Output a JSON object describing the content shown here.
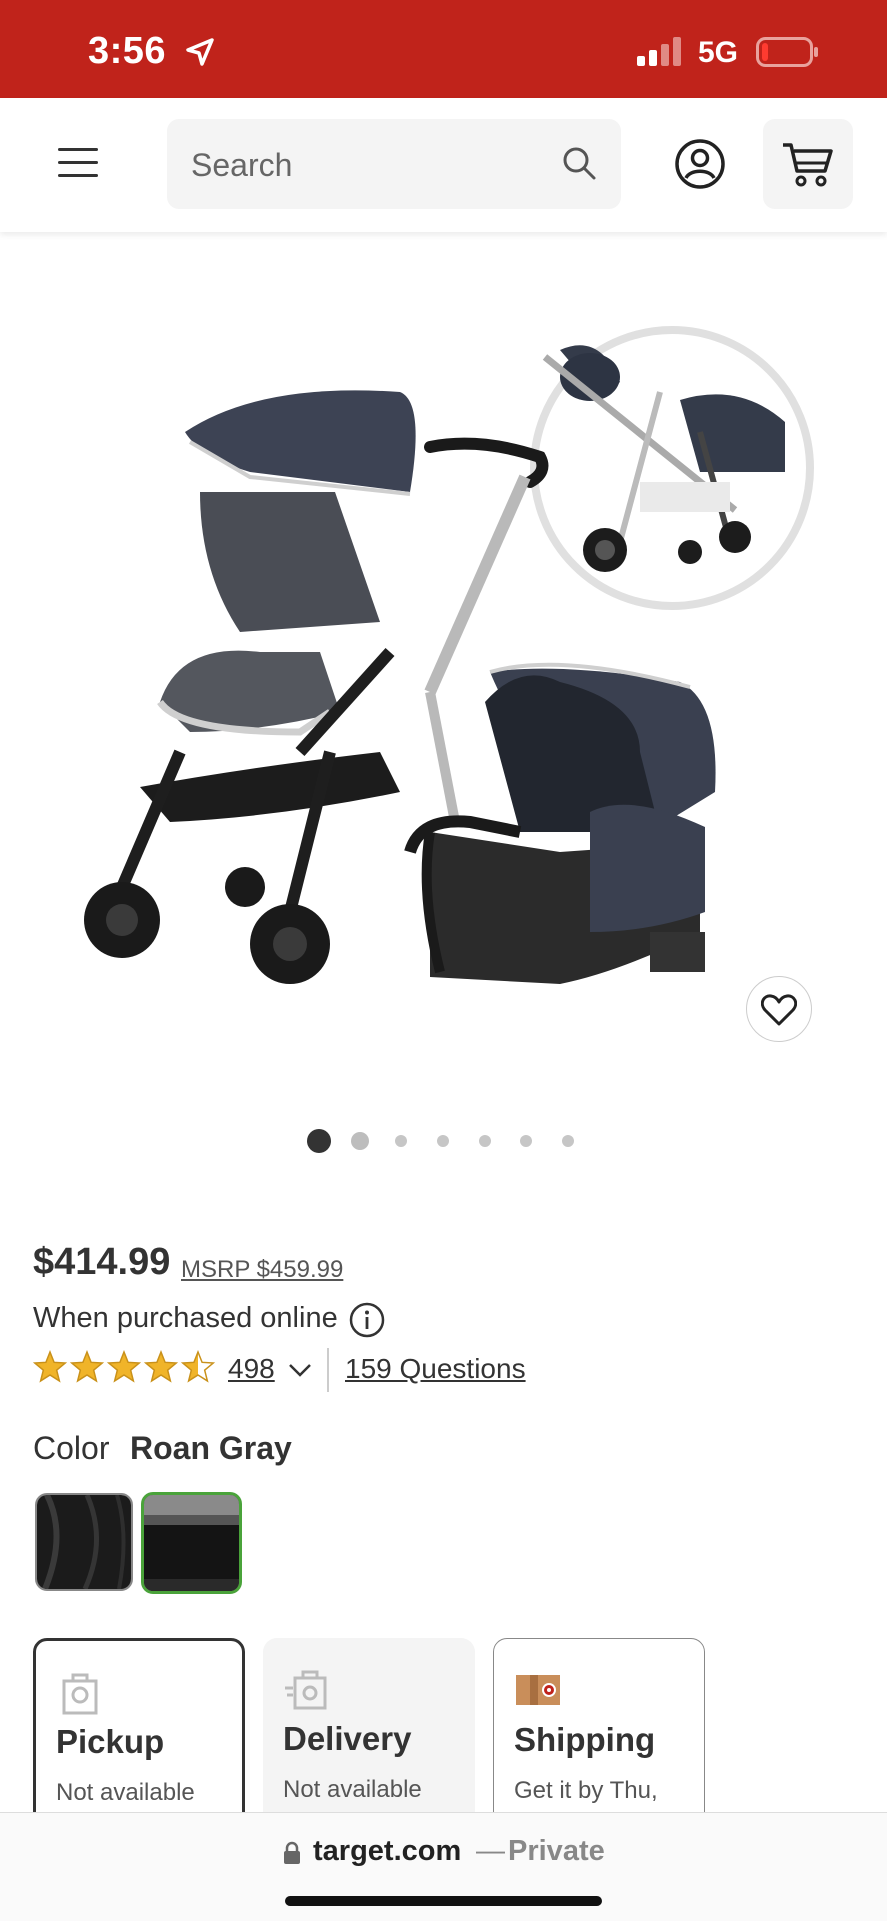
{
  "status_bar": {
    "time": "3:56",
    "network": "5G",
    "background_color": "#c0231b"
  },
  "header": {
    "menu_icon": "hamburger-menu-icon",
    "search_placeholder": "Search",
    "search_icon": "search-icon",
    "account_icon": "account-icon",
    "cart_icon": "cart-icon"
  },
  "product": {
    "image_alt": "Stroller and infant car seat travel system",
    "carousel": {
      "total": 7,
      "active": 1
    },
    "price": "$414.99",
    "msrp": "MSRP $459.99",
    "purchase_note": "When purchased online",
    "rating": {
      "stars": 4.5,
      "max": 5
    },
    "reviews_count": "498",
    "questions": "159 Questions",
    "color_label": "Color",
    "color_value": "Roan Gray",
    "swatches": [
      {
        "name": "black",
        "selected": false
      },
      {
        "name": "Roan Gray",
        "selected": true
      }
    ]
  },
  "fulfillment": [
    {
      "title": "Pickup",
      "subtitle": "Not available",
      "icon": "store-pickup-icon"
    },
    {
      "title": "Delivery",
      "subtitle": "Not available",
      "icon": "same-day-delivery-icon"
    },
    {
      "title": "Shipping",
      "subtitle": "Get it by Thu,",
      "icon": "shipping-box-icon"
    }
  ],
  "browser": {
    "domain": "target.com",
    "separator": "—",
    "mode": "Private"
  },
  "colors": {
    "brand_red": "#c0231b",
    "rating_star": "#f0b429",
    "selected_swatch": "#4aa33a",
    "text": "#333333"
  }
}
